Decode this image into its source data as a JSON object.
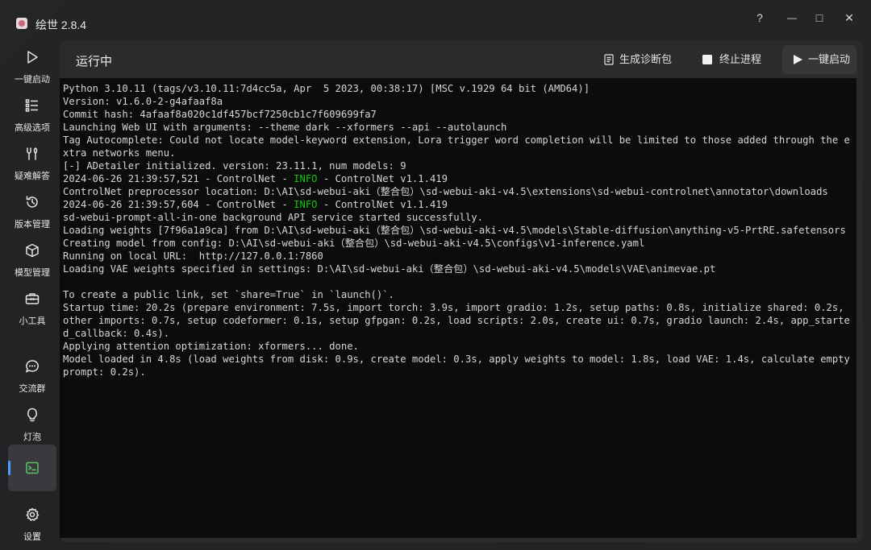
{
  "app": {
    "title": "绘世 2.8.4",
    "help_glyph": "?",
    "minimize_glyph": "—",
    "maximize_glyph": "□",
    "close_glyph": "✕"
  },
  "sidebar": {
    "items": [
      {
        "label": "一键启动",
        "icon": "play-icon"
      },
      {
        "label": "高级选项",
        "icon": "list-icon"
      },
      {
        "label": "疑难解答",
        "icon": "tools-icon"
      },
      {
        "label": "版本管理",
        "icon": "history-icon"
      },
      {
        "label": "模型管理",
        "icon": "cube-icon"
      },
      {
        "label": "小工具",
        "icon": "toolbox-icon"
      },
      {
        "label": "交流群",
        "icon": "chat-icon"
      },
      {
        "label": "灯泡",
        "icon": "bulb-icon"
      },
      {
        "label": "",
        "icon": "console-icon",
        "active": true
      },
      {
        "label": "设置",
        "icon": "gear-icon"
      }
    ]
  },
  "header": {
    "status": "运行中",
    "diagnose_label": "生成诊断包",
    "stop_label": "终止进程",
    "start_label": "一键启动"
  },
  "console": {
    "lines": [
      [
        {
          "t": "Python 3.10.11 (tags/v3.10.11:7d4cc5a, Apr  5 2023, 00:38:17) [MSC v.1929 64 bit (AMD64)]"
        }
      ],
      [
        {
          "t": "Version: v1.6.0-2-g4afaaf8a"
        }
      ],
      [
        {
          "t": "Commit hash: 4afaaf8a020c1df457bcf7250cb1c7f609699fa7"
        }
      ],
      [
        {
          "t": "Launching Web UI with arguments: --theme dark --xformers --api --autolaunch"
        }
      ],
      [
        {
          "t": "Tag Autocomplete: Could not locate model-keyword extension, Lora trigger word completion will be limited to those added through the extra networks menu."
        }
      ],
      [
        {
          "t": "[-] ADetailer initialized. version: 23.11.1, num models: 9"
        }
      ],
      [
        {
          "t": "2024-06-26 21:39:57,521 - ControlNet - "
        },
        {
          "t": "INFO",
          "c": "info"
        },
        {
          "t": " - ControlNet v1.1.419"
        }
      ],
      [
        {
          "t": "ControlNet preprocessor location: D:\\AI\\sd-webui-aki（整合包）\\sd-webui-aki-v4.5\\extensions\\sd-webui-controlnet\\annotator\\downloads"
        }
      ],
      [
        {
          "t": "2024-06-26 21:39:57,604 - ControlNet - "
        },
        {
          "t": "INFO",
          "c": "info"
        },
        {
          "t": " - ControlNet v1.1.419"
        }
      ],
      [
        {
          "t": "sd-webui-prompt-all-in-one background API service started successfully."
        }
      ],
      [
        {
          "t": "Loading weights [7f96a1a9ca] from D:\\AI\\sd-webui-aki（整合包）\\sd-webui-aki-v4.5\\models\\Stable-diffusion\\anything-v5-PrtRE.safetensors"
        }
      ],
      [
        {
          "t": "Creating model from config: D:\\AI\\sd-webui-aki（整合包）\\sd-webui-aki-v4.5\\configs\\v1-inference.yaml"
        }
      ],
      [
        {
          "t": "Running on local URL:  http://127.0.0.1:7860"
        }
      ],
      [
        {
          "t": "Loading VAE weights specified in settings: D:\\AI\\sd-webui-aki（整合包）\\sd-webui-aki-v4.5\\models\\VAE\\animevae.pt"
        }
      ],
      [
        {
          "t": ""
        }
      ],
      [
        {
          "t": "To create a public link, set `share=True` in `launch()`."
        }
      ],
      [
        {
          "t": "Startup time: 20.2s (prepare environment: 7.5s, import torch: 3.9s, import gradio: 1.2s, setup paths: 0.8s, initialize shared: 0.2s, other imports: 0.7s, setup codeformer: 0.1s, setup gfpgan: 0.2s, load scripts: 2.0s, create ui: 0.7s, gradio launch: 2.4s, app_started_callback: 0.4s)."
        }
      ],
      [
        {
          "t": "Applying attention optimization: xformers... done."
        }
      ],
      [
        {
          "t": "Model loaded in 4.8s (load weights from disk: 0.9s, create model: 0.3s, apply weights to model: 1.8s, load VAE: 1.4s, calculate empty prompt: 0.2s)."
        }
      ]
    ]
  },
  "colors": {
    "accent": "#4a9eff",
    "info": "#16c60c"
  }
}
